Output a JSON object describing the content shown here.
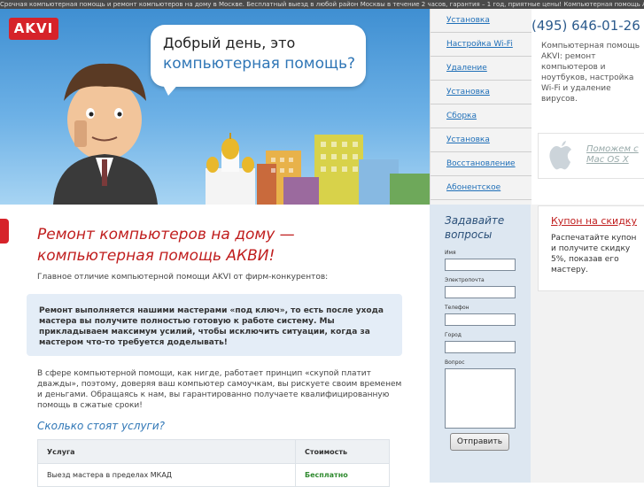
{
  "topbar": {
    "text": "Срочная компьютерная помощь и ремонт компьютеров на дому в Москве. Бесплатный выезд в любой район Москвы в течение 2 часов, гарантия – 1 год, приятные цены! Компьютерная помощь АКВИ"
  },
  "logo": {
    "text": "AKVI"
  },
  "bubble": {
    "line1": "Добрый день, это",
    "line2": "компьютерная помощь?"
  },
  "nav": {
    "items": [
      "Установка",
      "Настройка Wi-Fi",
      "Удаление",
      "Установка",
      "Сборка",
      "Установка",
      "Восстановление",
      "Абонентское"
    ]
  },
  "contact": {
    "phone": "(495) 646-01-26",
    "description": "Компьютерная помощь AKVI: ремонт компьютеров и ноутбуков, настройка Wi-Fi и удаление вирусов."
  },
  "mac": {
    "text": "Поможем с Mac OS X"
  },
  "coupon": {
    "title": "Купон на скидку",
    "text": "Распечатайте купон и получите скидку 5%, показав его мастеру."
  },
  "main": {
    "title": "Ремонт компьютеров на дому — компьютерная помощь АКВИ!",
    "intro": "Главное отличие компьютерной помощи AKVI от фирм-конкурентов:",
    "highlight": "Ремонт выполняется нашими мастерами «под ключ», то есть после ухода мастера вы получите полностью готовую к работе систему. Мы прикладываем максимум усилий, чтобы исключить ситуации, когда за мастером что-то требуется доделывать!",
    "paragraph": "В сфере компьютерной помощи, как нигде, работает принцип «скупой платит дважды», поэтому, доверяя ваш компьютер самоучкам, вы рискуете своим временем и деньгами. Обращаясь к нам, вы гарантированно получаете квалифицированную помощь в сжатые сроки!",
    "prices_title": "Сколько стоят услуги?",
    "table": {
      "headers": [
        "Услуга",
        "Стоимость"
      ],
      "rows": [
        [
          "Выезд мастера в пределах МКАД",
          "Бесплатно"
        ]
      ]
    }
  },
  "form": {
    "title": "Задавайте вопросы",
    "name_label": "Имя",
    "email_label": "Электропочта",
    "phone_label": "Телефон",
    "city_label": "Город",
    "question_label": "Вопрос",
    "submit": "Отправить"
  }
}
